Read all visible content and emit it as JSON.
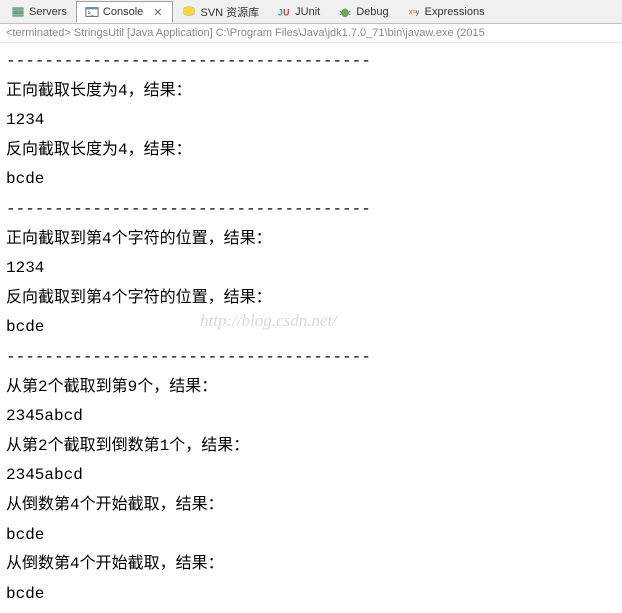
{
  "tabs": [
    {
      "label": "Servers",
      "icon": "servers-icon"
    },
    {
      "label": "Console",
      "icon": "console-icon",
      "active": true
    },
    {
      "label": "SVN 资源库",
      "icon": "svn-icon"
    },
    {
      "label": "JUnit",
      "icon": "junit-icon"
    },
    {
      "label": "Debug",
      "icon": "debug-icon"
    },
    {
      "label": "Expressions",
      "icon": "expressions-icon"
    }
  ],
  "close_marker": "✕",
  "console_header": "<terminated> StringsUtil [Java Application] C:\\Program Files\\Java\\jdk1.7.0_71\\bin\\javaw.exe (2015",
  "watermark": "http://blog.csdn.net/",
  "output_lines": [
    "--------------------------------------",
    "正向截取长度为4，结果：",
    "1234",
    "反向截取长度为4，结果：",
    "bcde",
    "--------------------------------------",
    "正向截取到第4个字符的位置，结果：",
    "1234",
    "反向截取到第4个字符的位置，结果：",
    "bcde",
    "--------------------------------------",
    "从第2个截取到第9个，结果：",
    "2345abcd",
    "从第2个截取到倒数第1个，结果：",
    "2345abcd",
    "从倒数第4个开始截取，结果：",
    "bcde",
    "从倒数第4个开始截取，结果：",
    "bcde"
  ]
}
